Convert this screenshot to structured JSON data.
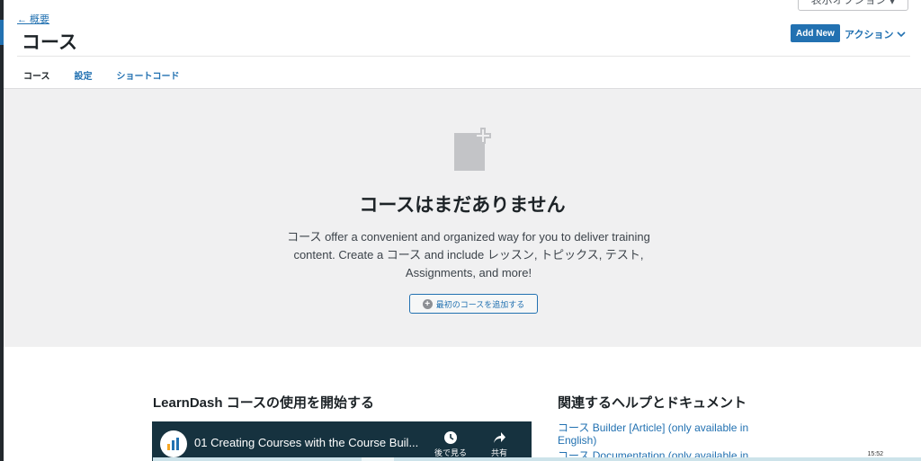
{
  "header": {
    "screen_options": "表示オプション",
    "back_link": "← 概要",
    "title": "コース",
    "add_new": "Add New",
    "actions": "アクション"
  },
  "tabs": [
    {
      "label": "コース",
      "active": true
    },
    {
      "label": "設定",
      "active": false
    },
    {
      "label": "ショートコード",
      "active": false
    }
  ],
  "empty_state": {
    "title": "コースはまだありません",
    "description": "コース offer a convenient and organized way for you to deliver training content. Create a コース and include レッスン, トピックス, テスト, Assignments, and more!",
    "add_button": "最初のコースを追加する"
  },
  "get_started": {
    "heading": "LearnDash コースの使用を開始する",
    "video_title": "01 Creating Courses with the Course Buil...",
    "watch_later": "後で見る",
    "share": "共有"
  },
  "related": {
    "heading": "関連するヘルプとドキュメント",
    "links": [
      "コース Builder [Article] (only available in English)",
      "コース Documentation (only available in"
    ]
  },
  "taskbar": {
    "clock": "15:52"
  },
  "colors": {
    "accent": "#2271b1",
    "panel_bg": "#f0f0f1",
    "video_bg": "#16323f"
  }
}
